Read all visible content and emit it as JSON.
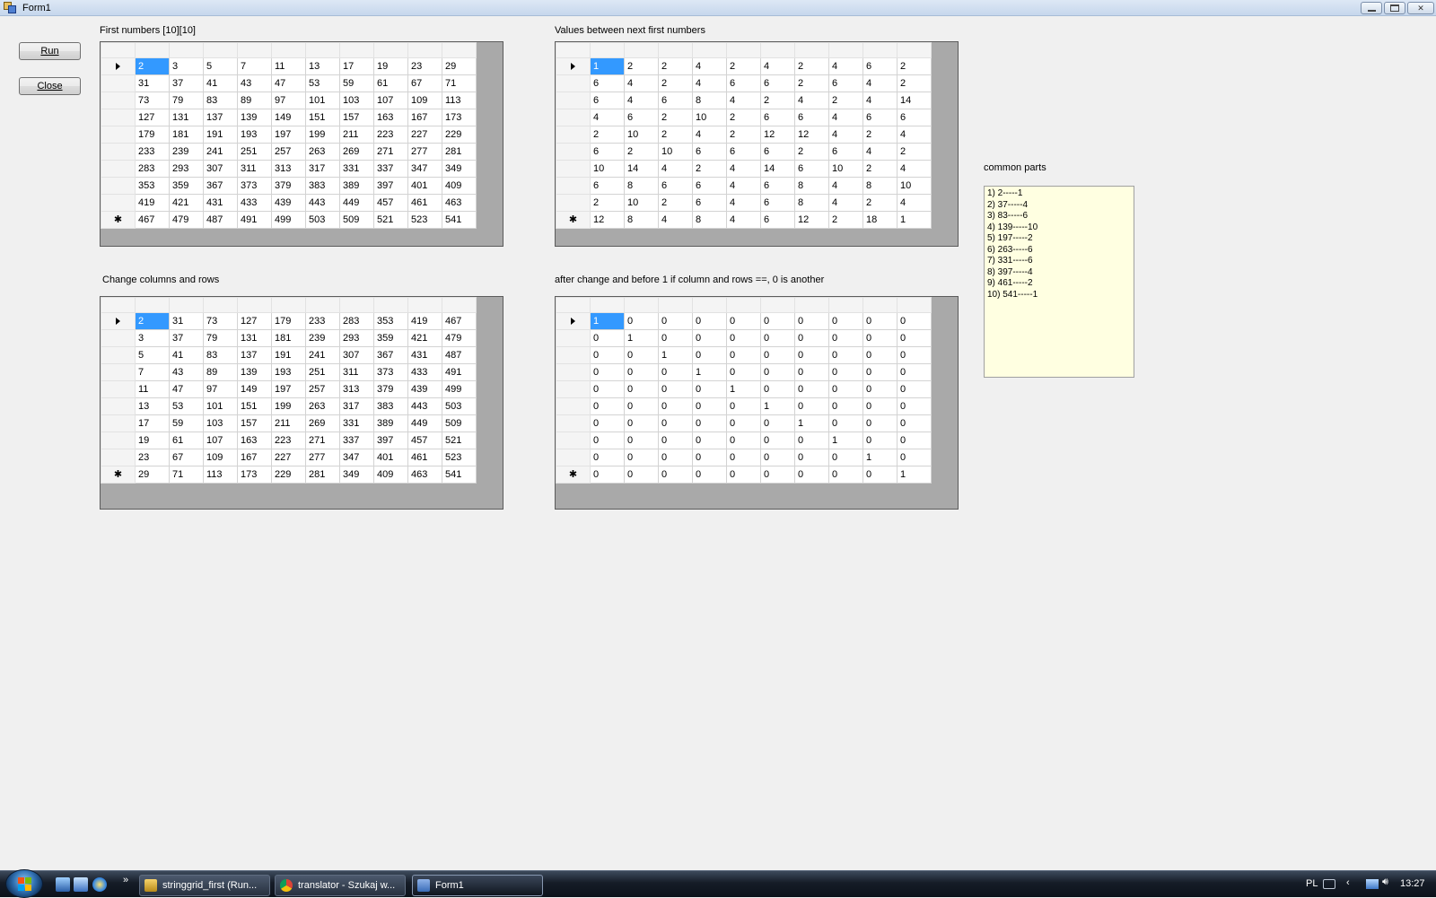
{
  "window": {
    "title": "Form1"
  },
  "buttons": {
    "run": "Run",
    "close": "Close"
  },
  "labels": {
    "grid1": "First numbers [10][10]",
    "grid2": "Values between next first numbers",
    "grid3": "Change columns and rows",
    "grid4": "after change and before  1 if column and rows ==, 0 is another",
    "common": "common parts"
  },
  "grids": {
    "first_numbers": [
      [
        "2",
        "3",
        "5",
        "7",
        "11",
        "13",
        "17",
        "19",
        "23",
        "29"
      ],
      [
        "31",
        "37",
        "41",
        "43",
        "47",
        "53",
        "59",
        "61",
        "67",
        "71"
      ],
      [
        "73",
        "79",
        "83",
        "89",
        "97",
        "101",
        "103",
        "107",
        "109",
        "113"
      ],
      [
        "127",
        "131",
        "137",
        "139",
        "149",
        "151",
        "157",
        "163",
        "167",
        "173"
      ],
      [
        "179",
        "181",
        "191",
        "193",
        "197",
        "199",
        "211",
        "223",
        "227",
        "229"
      ],
      [
        "233",
        "239",
        "241",
        "251",
        "257",
        "263",
        "269",
        "271",
        "277",
        "281"
      ],
      [
        "283",
        "293",
        "307",
        "311",
        "313",
        "317",
        "331",
        "337",
        "347",
        "349"
      ],
      [
        "353",
        "359",
        "367",
        "373",
        "379",
        "383",
        "389",
        "397",
        "401",
        "409"
      ],
      [
        "419",
        "421",
        "431",
        "433",
        "439",
        "443",
        "449",
        "457",
        "461",
        "463"
      ],
      [
        "467",
        "479",
        "487",
        "491",
        "499",
        "503",
        "509",
        "521",
        "523",
        "541"
      ]
    ],
    "values_between": [
      [
        "1",
        "2",
        "2",
        "4",
        "2",
        "4",
        "2",
        "4",
        "6",
        "2"
      ],
      [
        "6",
        "4",
        "2",
        "4",
        "6",
        "6",
        "2",
        "6",
        "4",
        "2"
      ],
      [
        "6",
        "4",
        "6",
        "8",
        "4",
        "2",
        "4",
        "2",
        "4",
        "14"
      ],
      [
        "4",
        "6",
        "2",
        "10",
        "2",
        "6",
        "6",
        "4",
        "6",
        "6"
      ],
      [
        "2",
        "10",
        "2",
        "4",
        "2",
        "12",
        "12",
        "4",
        "2",
        "4"
      ],
      [
        "6",
        "2",
        "10",
        "6",
        "6",
        "6",
        "2",
        "6",
        "4",
        "2"
      ],
      [
        "10",
        "14",
        "4",
        "2",
        "4",
        "14",
        "6",
        "10",
        "2",
        "4"
      ],
      [
        "6",
        "8",
        "6",
        "6",
        "4",
        "6",
        "8",
        "4",
        "8",
        "10"
      ],
      [
        "2",
        "10",
        "2",
        "6",
        "4",
        "6",
        "8",
        "4",
        "2",
        "4"
      ],
      [
        "12",
        "8",
        "4",
        "8",
        "4",
        "6",
        "12",
        "2",
        "18",
        "1"
      ]
    ],
    "transposed": [
      [
        "2",
        "31",
        "73",
        "127",
        "179",
        "233",
        "283",
        "353",
        "419",
        "467"
      ],
      [
        "3",
        "37",
        "79",
        "131",
        "181",
        "239",
        "293",
        "359",
        "421",
        "479"
      ],
      [
        "5",
        "41",
        "83",
        "137",
        "191",
        "241",
        "307",
        "367",
        "431",
        "487"
      ],
      [
        "7",
        "43",
        "89",
        "139",
        "193",
        "251",
        "311",
        "373",
        "433",
        "491"
      ],
      [
        "11",
        "47",
        "97",
        "149",
        "197",
        "257",
        "313",
        "379",
        "439",
        "499"
      ],
      [
        "13",
        "53",
        "101",
        "151",
        "199",
        "263",
        "317",
        "383",
        "443",
        "503"
      ],
      [
        "17",
        "59",
        "103",
        "157",
        "211",
        "269",
        "331",
        "389",
        "449",
        "509"
      ],
      [
        "19",
        "61",
        "107",
        "163",
        "223",
        "271",
        "337",
        "397",
        "457",
        "521"
      ],
      [
        "23",
        "67",
        "109",
        "167",
        "227",
        "277",
        "347",
        "401",
        "461",
        "523"
      ],
      [
        "29",
        "71",
        "113",
        "173",
        "229",
        "281",
        "349",
        "409",
        "463",
        "541"
      ]
    ],
    "comparison": [
      [
        "1",
        "0",
        "0",
        "0",
        "0",
        "0",
        "0",
        "0",
        "0",
        "0"
      ],
      [
        "0",
        "1",
        "0",
        "0",
        "0",
        "0",
        "0",
        "0",
        "0",
        "0"
      ],
      [
        "0",
        "0",
        "1",
        "0",
        "0",
        "0",
        "0",
        "0",
        "0",
        "0"
      ],
      [
        "0",
        "0",
        "0",
        "1",
        "0",
        "0",
        "0",
        "0",
        "0",
        "0"
      ],
      [
        "0",
        "0",
        "0",
        "0",
        "1",
        "0",
        "0",
        "0",
        "0",
        "0"
      ],
      [
        "0",
        "0",
        "0",
        "0",
        "0",
        "1",
        "0",
        "0",
        "0",
        "0"
      ],
      [
        "0",
        "0",
        "0",
        "0",
        "0",
        "0",
        "1",
        "0",
        "0",
        "0"
      ],
      [
        "0",
        "0",
        "0",
        "0",
        "0",
        "0",
        "0",
        "1",
        "0",
        "0"
      ],
      [
        "0",
        "0",
        "0",
        "0",
        "0",
        "0",
        "0",
        "0",
        "1",
        "0"
      ],
      [
        "0",
        "0",
        "0",
        "0",
        "0",
        "0",
        "0",
        "0",
        "0",
        "1"
      ]
    ]
  },
  "common_parts": [
    "1) 2-----1",
    "2) 37-----4",
    "3) 83-----6",
    "4) 139-----10",
    "5) 197-----2",
    "6) 263-----6",
    "7) 331-----6",
    "8) 397-----4",
    "9) 461-----2",
    "10) 541-----1"
  ],
  "taskbar": {
    "tasks": [
      "stringgrid_first (Run...",
      "translator - Szukaj w...",
      "Form1"
    ],
    "language": "PL",
    "time": "13:27"
  },
  "icons": {
    "start": "windows-start-orb",
    "current_row": "row-pointer-arrow",
    "new_row": "new-row-asterisk"
  },
  "colors": {
    "selection": "#3399ff",
    "common_box": "#ffffe1",
    "grid_background": "#a9a9a9"
  }
}
